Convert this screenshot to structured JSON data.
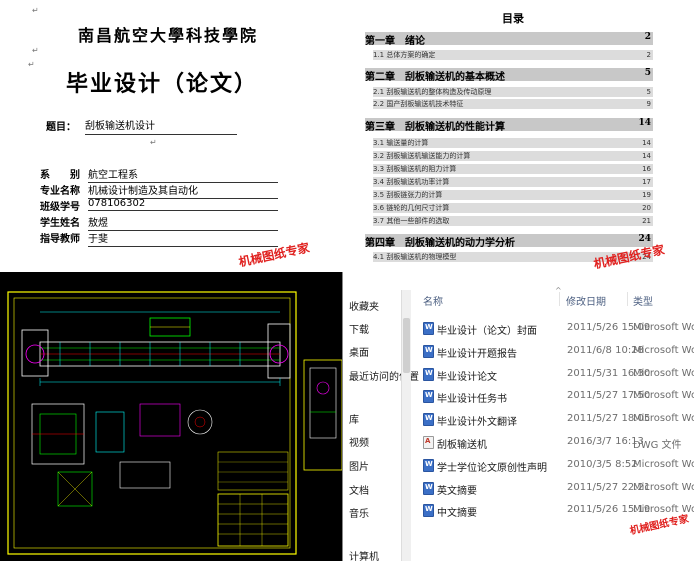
{
  "cover": {
    "university": "南昌航空大學科技學院",
    "title": "毕业设计（论文）",
    "topic_label": "题目：",
    "topic_value": "刮板输送机设计",
    "fields": [
      {
        "label": "系　　别",
        "value": "航空工程系"
      },
      {
        "label": "专业名称",
        "value": "机械设计制造及其自动化"
      },
      {
        "label": "班级学号",
        "value": "078106302"
      },
      {
        "label": "学生姓名",
        "value": "敖煜"
      },
      {
        "label": "指导教师",
        "value": "于斐"
      }
    ],
    "watermark": "机械图纸专家"
  },
  "toc": {
    "title": "目录",
    "watermark": "机械图纸专家",
    "entries": [
      {
        "kind": "chapter",
        "text": "第一章　绪论",
        "page": "2"
      },
      {
        "kind": "item",
        "text": "1.1 总体方案的确定",
        "page": "2"
      },
      {
        "kind": "chapter",
        "text": "第二章　刮板输送机的基本概述",
        "page": "5"
      },
      {
        "kind": "item",
        "text": "2.1 刮板输送机的整体构造及传动原理",
        "page": "5"
      },
      {
        "kind": "item",
        "text": "2.2 国产刮板输送机技术特征",
        "page": "9"
      },
      {
        "kind": "chapter",
        "text": "第三章　刮板输送机的性能计算",
        "page": "14"
      },
      {
        "kind": "item",
        "text": "3.1 输送量的计算",
        "page": "14"
      },
      {
        "kind": "item",
        "text": "3.2 刮板输送机输送能力的计算",
        "page": "14"
      },
      {
        "kind": "item",
        "text": "3.3 刮板输送机的阻力计算",
        "page": "16"
      },
      {
        "kind": "item",
        "text": "3.4 刮板输送机功率计算",
        "page": "17"
      },
      {
        "kind": "item",
        "text": "3.5 刮板链张力的计算",
        "page": "19"
      },
      {
        "kind": "item",
        "text": "3.6 链轮的几何尺寸计算",
        "page": "20"
      },
      {
        "kind": "item",
        "text": "3.7 其他一些部件的选取",
        "page": "21"
      },
      {
        "kind": "chapter",
        "text": "第四章　刮板输送机的动力学分析",
        "page": "24"
      },
      {
        "kind": "item",
        "text": "4.1 刮板输送机的物理模型",
        "page": "24"
      }
    ]
  },
  "explorer": {
    "nav": [
      "收藏夹",
      "下载",
      "桌面",
      "最近访问的位置",
      "库",
      "视频",
      "图片",
      "文档",
      "音乐",
      "计算机"
    ],
    "columns": {
      "name": "名称",
      "date": "修改日期",
      "type": "类型"
    },
    "files": [
      {
        "name": "毕业设计（论文）封面",
        "date": "2011/5/26 15:09",
        "type": "Microsoft Wor",
        "icon": "doc"
      },
      {
        "name": "毕业设计开题报告",
        "date": "2011/6/8 10:28",
        "type": "Microsoft Wor",
        "icon": "doc"
      },
      {
        "name": "毕业设计论文",
        "date": "2011/5/31 16:30",
        "type": "Microsoft Wor",
        "icon": "doc"
      },
      {
        "name": "毕业设计任务书",
        "date": "2011/5/27 17:50",
        "type": "Microsoft Wor",
        "icon": "doc"
      },
      {
        "name": "毕业设计外文翻译",
        "date": "2011/5/27 18:05",
        "type": "Microsoft Wor",
        "icon": "doc"
      },
      {
        "name": "刮板输送机",
        "date": "2016/3/7 16:13",
        "type": "DWG 文件",
        "icon": "dwg"
      },
      {
        "name": "学士学位论文原创性声明",
        "date": "2010/3/5 8:52",
        "type": "Microsoft Wor",
        "icon": "doc"
      },
      {
        "name": "英文摘要",
        "date": "2011/5/27 22:21",
        "type": "Microsoft Wor",
        "icon": "doc"
      },
      {
        "name": "中文摘要",
        "date": "2011/5/26 15:19",
        "type": "Microsoft Wor",
        "icon": "doc"
      }
    ],
    "watermark": "机械图纸专家"
  },
  "colors": {
    "cad_background": "#000000",
    "cad_frame": "#ffff00",
    "cad_green": "#00ff00",
    "cad_cyan": "#00ffff",
    "cad_red": "#ff0000",
    "cad_magenta": "#ff00ff",
    "watermark": "#e0211f",
    "toc_chapter_bg": "#c8c8c8"
  }
}
